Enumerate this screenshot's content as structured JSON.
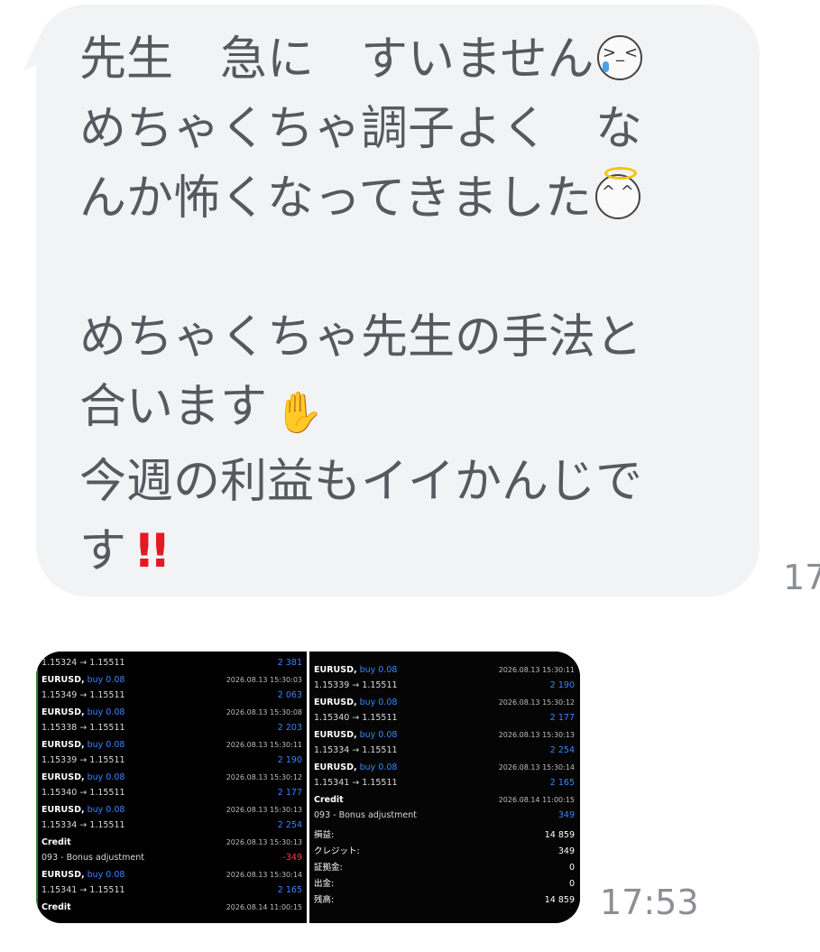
{
  "message": {
    "lines": [
      "先生　急に　すいません",
      "めちゃくちゃ調子よく　な",
      "んか怖くなってきました",
      "",
      "めちゃくちゃ先生の手法と",
      "合います",
      "今週の利益もイイかんじで",
      "す"
    ],
    "time": "17",
    "emoji_1": "crying-face-icon",
    "emoji_2": "angel-face-icon",
    "emoji_3": "ok-hand-icon",
    "emoji_4": "double-exclamation-icon",
    "bangs": "!!"
  },
  "image": {
    "time": "17:53",
    "left": [
      {
        "a_sym": "",
        "a_mid": "",
        "a_ts": "",
        "b_px": "1.15324 → 1.15511",
        "b_val": "2 381",
        "b_cls": "pos"
      },
      {
        "a_sym": "EURUSD,",
        "a_mid": "buy 0.08",
        "a_ts": "2026.08.13 15:30:03",
        "b_px": "1.15349 → 1.15511",
        "b_val": "2 063",
        "b_cls": "pos"
      },
      {
        "a_sym": "EURUSD,",
        "a_mid": "buy 0.08",
        "a_ts": "2026.08.13 15:30:08",
        "b_px": "1.15338 → 1.15511",
        "b_val": "2 203",
        "b_cls": "pos"
      },
      {
        "a_sym": "EURUSD,",
        "a_mid": "buy 0.08",
        "a_ts": "2026.08.13 15:30:11",
        "b_px": "1.15339 → 1.15511",
        "b_val": "2 190",
        "b_cls": "pos"
      },
      {
        "a_sym": "EURUSD,",
        "a_mid": "buy 0.08",
        "a_ts": "2026.08.13 15:30:12",
        "b_px": "1.15340 → 1.15511",
        "b_val": "2 177",
        "b_cls": "pos"
      },
      {
        "a_sym": "EURUSD,",
        "a_mid": "buy 0.08",
        "a_ts": "2026.08.13 15:30:13",
        "b_px": "1.15334 → 1.15511",
        "b_val": "2 254",
        "b_cls": "pos"
      },
      {
        "a_sym": "Credit",
        "a_mid": "",
        "a_ts": "2026.08.13 15:30:13",
        "b_px": "093 - Bonus adjustment",
        "b_val": "-349",
        "b_cls": "neg"
      },
      {
        "a_sym": "EURUSD,",
        "a_mid": "buy 0.08",
        "a_ts": "2026.08.13 15:30:14",
        "b_px": "1.15341 → 1.15511",
        "b_val": "2 165",
        "b_cls": "pos"
      },
      {
        "a_sym": "Credit",
        "a_mid": "",
        "a_ts": "2026.08.14 11:00:15",
        "b_px": "",
        "b_val": "",
        "b_cls": "pos"
      }
    ],
    "right": [
      {
        "a_sym": "EURUSD,",
        "a_mid": "buy 0.08",
        "a_ts": "2026.08.13 15:30:11",
        "b_px": "1.15339 → 1.15511",
        "b_val": "2 190",
        "b_cls": "pos"
      },
      {
        "a_sym": "EURUSD,",
        "a_mid": "buy 0.08",
        "a_ts": "2026.08.13 15:30:12",
        "b_px": "1.15340 → 1.15511",
        "b_val": "2 177",
        "b_cls": "pos"
      },
      {
        "a_sym": "EURUSD,",
        "a_mid": "buy 0.08",
        "a_ts": "2026.08.13 15:30:13",
        "b_px": "1.15334 → 1.15511",
        "b_val": "2 254",
        "b_cls": "pos"
      },
      {
        "a_sym": "EURUSD,",
        "a_mid": "buy 0.08",
        "a_ts": "2026.08.13 15:30:14",
        "b_px": "1.15341 → 1.15511",
        "b_val": "2 165",
        "b_cls": "pos"
      },
      {
        "a_sym": "Credit",
        "a_mid": "",
        "a_ts": "2026.08.14 11:00:15",
        "b_px": "093 - Bonus adjustment",
        "b_val": "349",
        "b_cls": "pos"
      }
    ],
    "summary": [
      {
        "label": "損益:",
        "value": "14 859"
      },
      {
        "label": "クレジット:",
        "value": "349"
      },
      {
        "label": "証拠金:",
        "value": "0"
      },
      {
        "label": "出金:",
        "value": "0"
      },
      {
        "label": "残高:",
        "value": "14 859"
      }
    ]
  }
}
